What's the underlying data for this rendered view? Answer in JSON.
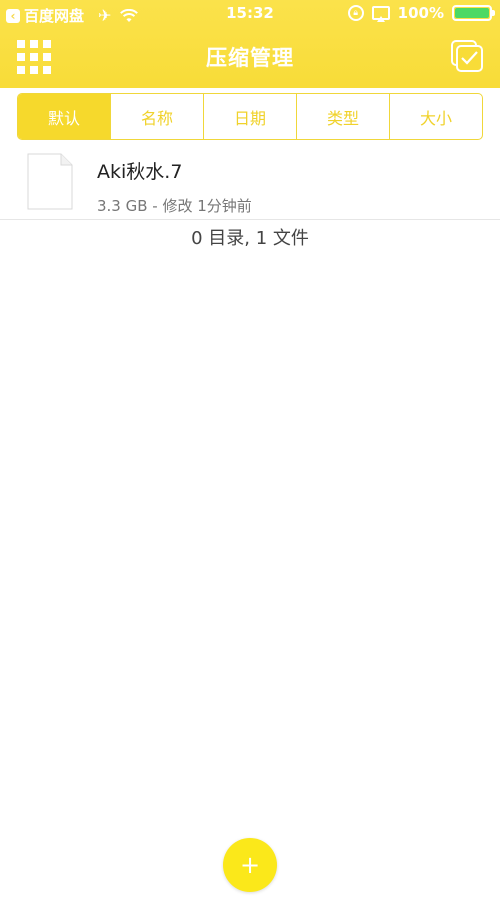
{
  "status_bar": {
    "back_app": "百度网盘",
    "time": "15:32",
    "battery": "100%"
  },
  "nav": {
    "title": "压缩管理"
  },
  "segments": [
    "默认",
    "名称",
    "日期",
    "类型",
    "大小"
  ],
  "files": [
    {
      "name": "Aki秋水.7",
      "meta": "3.3 GB - 修改 1分钟前"
    }
  ],
  "summary": "0 目录, 1 文件",
  "fab": {
    "label": "+"
  },
  "colors": {
    "accent": "#f8dc38",
    "segment_active": "#f6d92c",
    "fab": "#fbe81a"
  },
  "icons": {
    "grid": "grid-menu-icon",
    "select": "checkbox-select-icon",
    "file": "file-icon"
  }
}
